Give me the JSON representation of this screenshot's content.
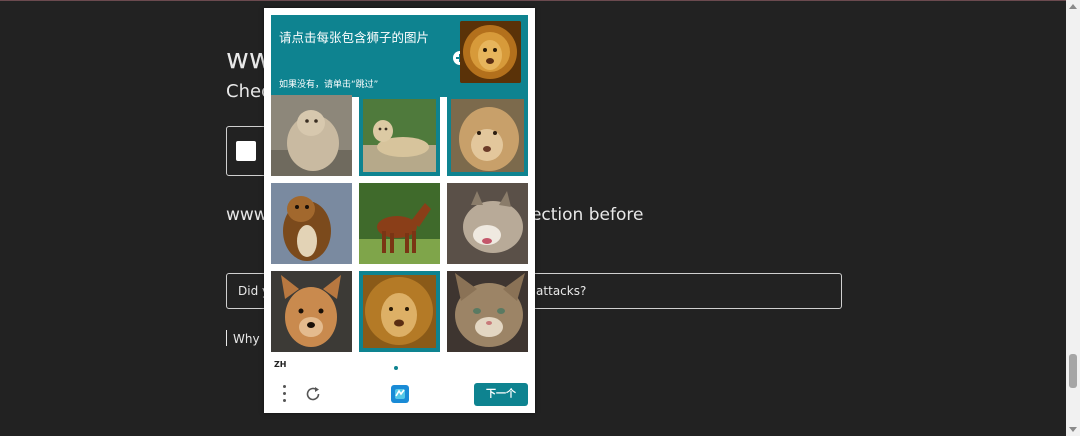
{
  "page": {
    "title": "www.com",
    "subtitle": "Chec",
    "review_text": "www view the security of your connection before",
    "notice": "Did y protect you from malware and other digital attacks?",
    "why": "Why a"
  },
  "captcha": {
    "prompt_title": "请点击每张包含狮子的图片",
    "prompt_sub": "如果没有，请单击“跳过”",
    "language": "ZH",
    "next_label": "下一个",
    "accent_color": "#0e8390",
    "tiles": [
      {
        "subject": "lioness",
        "selected": false
      },
      {
        "subject": "lioness",
        "selected": true
      },
      {
        "subject": "lioness",
        "selected": true
      },
      {
        "subject": "dog",
        "selected": false
      },
      {
        "subject": "horse",
        "selected": false
      },
      {
        "subject": "cat",
        "selected": false
      },
      {
        "subject": "dog",
        "selected": false
      },
      {
        "subject": "lion",
        "selected": true
      },
      {
        "subject": "cat",
        "selected": false
      }
    ]
  }
}
